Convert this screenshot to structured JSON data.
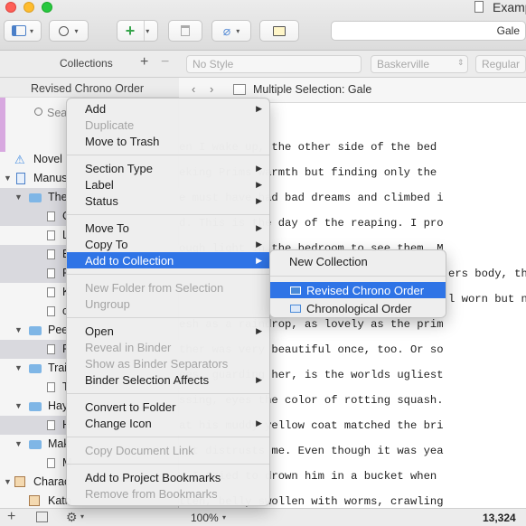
{
  "window": {
    "title": "Examp"
  },
  "toolbar": {
    "search_value": "Gale",
    "add_icon": "plus-icon",
    "colors": {
      "accent": "#2f74e6",
      "add_green": "#35a44a"
    }
  },
  "binder": {
    "header_title": "Collections",
    "collection_tab": "Revised Chrono Order",
    "search_placeholder": "Sea",
    "items": [
      {
        "label": "Novel",
        "icon": "warning-icon"
      },
      {
        "label": "Manus",
        "icon": "manuscript-icon"
      },
      {
        "label": "The",
        "icon": "folder-icon"
      },
      {
        "label": "C",
        "icon": "doc-icon"
      },
      {
        "label": "L",
        "icon": "doc-icon"
      },
      {
        "label": "E",
        "icon": "doc-icon"
      },
      {
        "label": "F",
        "icon": "doc-icon"
      },
      {
        "label": "K",
        "icon": "doc-icon"
      },
      {
        "label": "c",
        "icon": "doc-icon"
      },
      {
        "label": "Pee",
        "icon": "folder-icon"
      },
      {
        "label": "F",
        "icon": "doc-icon"
      },
      {
        "label": "Trai",
        "icon": "folder-icon"
      },
      {
        "label": "T",
        "icon": "doc-icon"
      },
      {
        "label": "Hay",
        "icon": "folder-icon"
      },
      {
        "label": "H",
        "icon": "doc-icon"
      },
      {
        "label": "Mak",
        "icon": "folder-icon"
      },
      {
        "label": "M",
        "icon": "doc-icon"
      },
      {
        "label": "Charac",
        "icon": "character-icon"
      },
      {
        "label": "Katn",
        "icon": "person-icon"
      }
    ]
  },
  "format_bar": {
    "style": "No Style",
    "font": "Baskerville",
    "weight": "Regular"
  },
  "editor": {
    "header_title": "Multiple Selection: Gale",
    "lines": [
      "en I wake up, the other side of the bed",
      "eking Prims warmth but finding only the",
      "e must have had bad dreams and climbed i",
      "d. This is the day of the reaping. I pro",
      "ough light in the bedroom to see them. M",
      "ers body, the",
      "l worn but no",
      "esh as a raindrop, as lovely as the prim",
      "ther was very beautiful once, too. Or so",
      "ees, guarding her, is the worlds ugliest",
      "ssing, eyes the color of rotting squash.",
      "at his muddy yellow coat matched the bri",
      "ast distrusts me. Even though it was yea",
      "w I tried to drown him in a bucket when",
      "tten, belly swollen with worms, crawling"
    ]
  },
  "footer": {
    "zoom": "100%",
    "word_count": "13,324"
  },
  "context_menu": {
    "items": [
      {
        "label": "Add",
        "submenu": true,
        "enabled": true
      },
      {
        "label": "Duplicate",
        "submenu": false,
        "enabled": false
      },
      {
        "label": "Move to Trash",
        "submenu": false,
        "enabled": true
      },
      {
        "label": "Section Type",
        "submenu": true,
        "enabled": true
      },
      {
        "label": "Label",
        "submenu": true,
        "enabled": true
      },
      {
        "label": "Status",
        "submenu": true,
        "enabled": true
      },
      {
        "label": "Move To",
        "submenu": true,
        "enabled": true
      },
      {
        "label": "Copy To",
        "submenu": true,
        "enabled": true
      },
      {
        "label": "Add to Collection",
        "submenu": true,
        "enabled": true,
        "highlighted": true
      },
      {
        "label": "New Folder from Selection",
        "submenu": false,
        "enabled": false
      },
      {
        "label": "Ungroup",
        "submenu": false,
        "enabled": false
      },
      {
        "label": "Open",
        "submenu": true,
        "enabled": true
      },
      {
        "label": "Reveal in Binder",
        "submenu": false,
        "enabled": false
      },
      {
        "label": "Show as Binder Separators",
        "submenu": false,
        "enabled": false
      },
      {
        "label": "Binder Selection Affects",
        "submenu": true,
        "enabled": true
      },
      {
        "label": "Convert to Folder",
        "submenu": false,
        "enabled": true
      },
      {
        "label": "Change Icon",
        "submenu": true,
        "enabled": true
      },
      {
        "label": "Copy Document Link",
        "submenu": false,
        "enabled": false
      },
      {
        "label": "Add to Project Bookmarks",
        "submenu": false,
        "enabled": true
      },
      {
        "label": "Remove from Bookmarks",
        "submenu": false,
        "enabled": false
      }
    ]
  },
  "submenu": {
    "new_collection": "New Collection",
    "collections": [
      {
        "label": "Revised Chrono Order",
        "highlighted": true
      },
      {
        "label": "Chronological Order",
        "highlighted": false
      }
    ]
  }
}
